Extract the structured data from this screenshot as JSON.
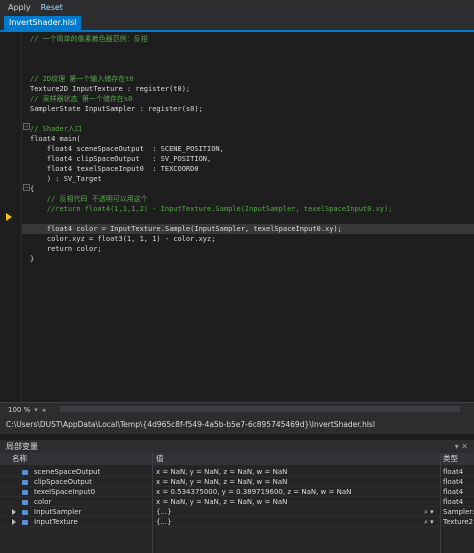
{
  "toolbar": {
    "apply_label": "Apply",
    "reset_label": "Reset"
  },
  "tab": {
    "label": "InvertShader.hlsl"
  },
  "editor": {
    "lines": [
      {
        "text": "// 一个简单的像素着色器范例：反相",
        "kind": "comment"
      },
      {
        "text": "",
        "kind": "plain"
      },
      {
        "text": "",
        "kind": "plain"
      },
      {
        "text": "// 2D纹理 第一个输入储存在t0",
        "kind": "comment"
      },
      {
        "text": "Texture2D InputTexture : register(t0);",
        "kind": "decl"
      },
      {
        "text": "// 采样器状态 第一个储存在s0",
        "kind": "comment"
      },
      {
        "text": "SamplerState InputSampler : register(s0);",
        "kind": "decl"
      },
      {
        "text": "",
        "kind": "plain"
      },
      {
        "text": "// Shader入口",
        "kind": "comment"
      },
      {
        "text": "float4 main(",
        "kind": "decl"
      },
      {
        "text": "    float4 sceneSpaceOutput  : SCENE_POSITION,",
        "kind": "decl"
      },
      {
        "text": "    float4 clipSpaceOutput   : SV_POSITION,",
        "kind": "decl"
      },
      {
        "text": "    float4 texelSpaceInput0  : TEXCOORD0",
        "kind": "decl"
      },
      {
        "text": "    ) : SV_Target",
        "kind": "plain"
      },
      {
        "text": "{",
        "kind": "plain"
      },
      {
        "text": "    // 反相代码 不透明可以用这个",
        "kind": "comment"
      },
      {
        "text": "    //return float4(1,1,1,2) - InputTexture.Sample(InputSampler, texelSpaceInput0.xy);",
        "kind": "comment"
      },
      {
        "text": "",
        "kind": "plain"
      },
      {
        "text": "    float4 color = InputTexture.Sample(InputSampler, texelSpaceInput0.xy);",
        "kind": "current"
      },
      {
        "text": "    color.xyz = float3(1, 1, 1) - color.xyz;",
        "kind": "decl"
      },
      {
        "text": "    return color;",
        "kind": "ret"
      },
      {
        "text": "}",
        "kind": "plain"
      }
    ]
  },
  "status": {
    "zoom": "100 %"
  },
  "path": {
    "text": "C:\\Users\\DUST\\AppData\\Local\\Temp\\{4d965c8f-f549-4a5b-b5e7-6c895745469d}\\InvertShader.hlsl"
  },
  "locals": {
    "title": "局部变量",
    "columns": {
      "name": "名称",
      "value": "值",
      "type": "类型"
    },
    "rows": [
      {
        "name": "sceneSpaceOutput",
        "value": "x = NaN, y = NaN, z = NaN, w = NaN",
        "type": "float4",
        "expandable": false
      },
      {
        "name": "clipSpaceOutput",
        "value": "x = NaN, y = NaN, z = NaN, w = NaN",
        "type": "float4",
        "expandable": false
      },
      {
        "name": "texelSpaceInput0",
        "value": "x = 0.534375000, y = 0.389719600, z = NaN, w = NaN",
        "type": "float4",
        "expandable": false
      },
      {
        "name": "color",
        "value": "x = NaN, y = NaN, z = NaN, w = NaN",
        "type": "float4",
        "expandable": false
      },
      {
        "name": "InputSampler",
        "value": "{...}",
        "type": "Sampler:",
        "expandable": true
      },
      {
        "name": "InputTexture",
        "value": "{...}",
        "type": "Texture2",
        "expandable": true
      }
    ]
  }
}
